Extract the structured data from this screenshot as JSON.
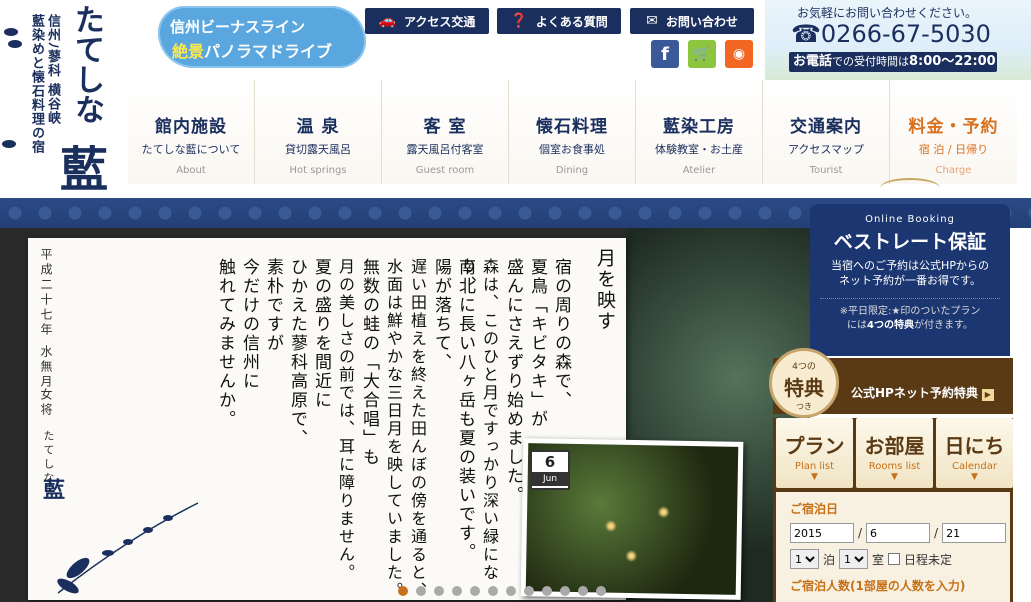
{
  "logo": {
    "subtitle_line1": "信州ﾉ蓼科 横谷峡",
    "subtitle_line2": "藍染めと懐石料理の宿",
    "brand": "たてしな",
    "brand_kanji": "藍"
  },
  "banner": {
    "line1": "信州ビーナスライン",
    "line2_highlight": "絶景",
    "line2_rest": "パノラマドライブ"
  },
  "top_buttons": [
    {
      "label": "アクセス交通",
      "icon": "car-icon"
    },
    {
      "label": "よくある質問",
      "icon": "question-icon"
    },
    {
      "label": "お問い合わせ",
      "icon": "mail-icon"
    }
  ],
  "social": [
    {
      "name": "facebook-icon",
      "glyph": "f",
      "color": "#3b5998"
    },
    {
      "name": "cart-icon",
      "glyph": "🛒",
      "color": "#8cc63f"
    },
    {
      "name": "rss-icon",
      "glyph": "◉",
      "color": "#f26522"
    }
  ],
  "contact": {
    "tagline": "お気軽にお問い合わせください。",
    "phone": "0266-67-5030",
    "hours_prefix": "お電話",
    "hours_mid": "での受付時間は",
    "hours_time": "8:00〜22:00"
  },
  "nav": [
    {
      "jp": "館内施設",
      "sub": "たてしな藍について",
      "en": "About"
    },
    {
      "jp": "温 泉",
      "sub": "貸切露天風呂",
      "en": "Hot springs"
    },
    {
      "jp": "客 室",
      "sub": "露天風呂付客室",
      "en": "Guest room"
    },
    {
      "jp": "懐石料理",
      "sub": "個室お食事処",
      "en": "Dining"
    },
    {
      "jp": "藍染工房",
      "sub": "体験教室・お土産",
      "en": "Atelier"
    },
    {
      "jp": "交通案内",
      "sub": "アクセスマップ",
      "en": "Tourist"
    },
    {
      "jp": "料金・予約",
      "sub": "宿 泊 / 日帰り",
      "en": "Charge"
    }
  ],
  "poem": {
    "title": "月を映す",
    "lines": [
      "宿の周りの森で、",
      "夏鳥「キビタキ」が",
      "盛んにさえずり始めました。",
      "森は、このひと月ですっかり深い緑になり、",
      "南北に長い八ヶ岳も夏の装いです。",
      "陽が落ちて、",
      "遅い田植えを終えた田んぼの傍を通ると、",
      "水面は鮮やかな三日月を映していました。",
      "無数の蛙の「大合唱」も",
      "月の美しさの前では、耳に障りません。",
      "夏の盛りを間近に",
      "ひかえた蓼科高原で、",
      "素朴ですが",
      "今だけの信州に",
      "触れてみませんか。"
    ],
    "date": "平成二十七年 水無月",
    "author": "女将",
    "sign_name": "たてしな",
    "sign_kanji": "藍"
  },
  "date_badge": {
    "day": "6",
    "month": "Jun"
  },
  "slider": {
    "total": 12,
    "active": 0
  },
  "booking": {
    "label": "Online Booking",
    "title": "ベストレート保証",
    "desc1": "当宿へのご予約は公式HPからの",
    "desc2": "ネット予約が一番お得です。",
    "note1": "※平日限定:★印のついたプラン",
    "note2_pre": "には",
    "note2_bold": "4つの特典",
    "note2_post": "が付きます。"
  },
  "tokuten": {
    "top": "4つの",
    "main": "特典",
    "bottom": "つき",
    "label": "公式HPネット予約特典"
  },
  "tabs": [
    {
      "jp": "プラン",
      "en": "Plan list"
    },
    {
      "jp": "お部屋",
      "en": "Rooms list"
    },
    {
      "jp": "日にち",
      "en": "Calendar"
    }
  ],
  "search": {
    "stay_date_label": "ご宿泊日",
    "year": "2015",
    "month": "6",
    "day": "21",
    "sep": "/",
    "nights": "1",
    "nights_unit": "泊",
    "rooms": "1",
    "rooms_unit": "室",
    "undecided": "日程未定",
    "guests_label": "ご宿泊人数(1部屋の人数を入力)"
  }
}
